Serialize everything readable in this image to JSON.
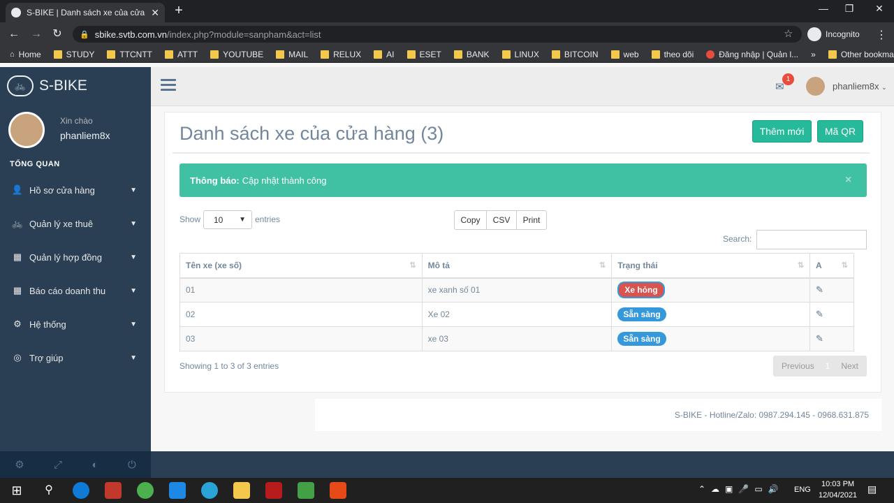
{
  "browser": {
    "tab_title": "S-BIKE | Danh sách xe của cửa hà",
    "url_host": "sbike.svtb.com.vn",
    "url_path": "/index.php?module=sanpham&act=list",
    "incognito_label": "Incognito",
    "bookmarks": [
      "Home",
      "STUDY",
      "TTCNTT",
      "ATTT",
      "YOUTUBE",
      "MAIL",
      "RELUX",
      "AI",
      "ESET",
      "BANK",
      "LINUX",
      "BITCOIN",
      "web",
      "theo dõi",
      "Đăng nhập | Quản l..."
    ],
    "bookmarks_more": "»",
    "other_bookmarks": "Other bookmarks"
  },
  "sidebar": {
    "brand": "S-BIKE",
    "greeting": "Xin chào",
    "username": "phanliem8x",
    "section_title": "TỔNG QUAN",
    "items": [
      {
        "label": "Hồ sơ cửa hàng",
        "icon": "user-icon"
      },
      {
        "label": "Quản lý xe thuê",
        "icon": "bicycle-icon"
      },
      {
        "label": "Quản lý hợp đồng",
        "icon": "qrcode-icon"
      },
      {
        "label": "Báo cáo doanh thu",
        "icon": "qrcode-icon"
      },
      {
        "label": "Hệ thống",
        "icon": "gear-icon"
      },
      {
        "label": "Trợ giúp",
        "icon": "lifering-icon"
      }
    ]
  },
  "topnav": {
    "mail_count": "1",
    "user": "phanliem8x"
  },
  "page": {
    "title": "Danh sách xe của cửa hàng (3)",
    "btn_add": "Thêm mới",
    "btn_qr": "Mã QR",
    "alert_label": "Thông báo:",
    "alert_text": "Cập nhật thành công",
    "alert_close": "×",
    "show_label": "Show",
    "page_length": "10",
    "entries_label": "entries",
    "btn_copy": "Copy",
    "btn_csv": "CSV",
    "btn_print": "Print",
    "search_label": "Search:",
    "columns": [
      "Tên xe (xe số)",
      "Mô tả",
      "Trạng thái",
      "A"
    ],
    "rows": [
      {
        "name": "01",
        "desc": "xe xanh số 01",
        "status": "Xe hỏng"
      },
      {
        "name": "02",
        "desc": "Xe 02",
        "status": "Sẵn sàng"
      },
      {
        "name": "03",
        "desc": "xe 03",
        "status": "Sẵn sàng"
      }
    ],
    "info": "Showing 1 to 3 of 3 entries",
    "pager_prev": "Previous",
    "pager_current": "1",
    "pager_next": "Next",
    "footer": "S-BIKE - Hotline/Zalo: 0987.294.145 - 0968.631.875"
  },
  "taskbar": {
    "lang": "ENG",
    "time": "10:03 PM",
    "date": "12/04/2021"
  },
  "colors": {
    "sidebar": "#2a3f54",
    "accent": "#26b99a",
    "alert": "#40c1a3",
    "danger": "#d9534f",
    "info": "#3498db"
  }
}
